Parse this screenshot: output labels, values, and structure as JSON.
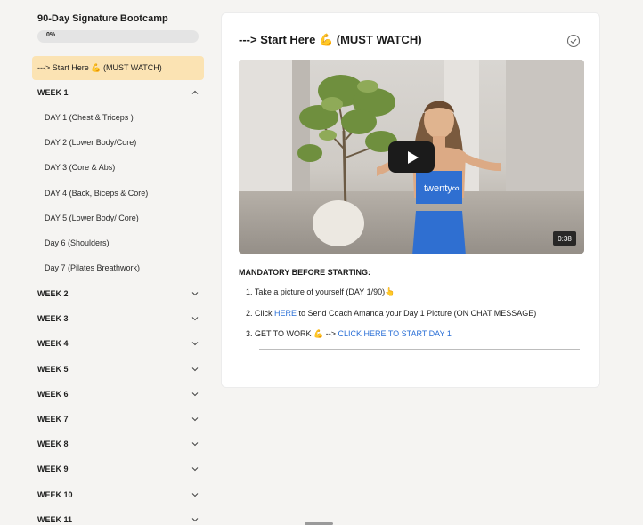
{
  "sidebar": {
    "course_title": "90-Day Signature Bootcamp",
    "progress_label": "0%",
    "progress_value": 0,
    "active_item": "---> Start Here 💪 (MUST WATCH)",
    "weeks": [
      {
        "label": "WEEK 1",
        "expanded": true
      },
      {
        "label": "WEEK 2",
        "expanded": false
      },
      {
        "label": "WEEK 3",
        "expanded": false
      },
      {
        "label": "WEEK 4",
        "expanded": false
      },
      {
        "label": "WEEK 5",
        "expanded": false
      },
      {
        "label": "WEEK 6",
        "expanded": false
      },
      {
        "label": "WEEK 7",
        "expanded": false
      },
      {
        "label": "WEEK 8",
        "expanded": false
      },
      {
        "label": "WEEK 9",
        "expanded": false
      },
      {
        "label": "WEEK 10",
        "expanded": false
      },
      {
        "label": "WEEK 11",
        "expanded": false
      }
    ],
    "week1_days": [
      "DAY 1 (Chest & Triceps )",
      "DAY 2 (Lower Body/Core)",
      "DAY 3 (Core & Abs)",
      "DAY 4 (Back, Biceps & Core)",
      "DAY 5 (Lower Body/ Core)",
      "Day 6 (Shoulders)",
      "Day 7 (Pilates Breathwork)"
    ]
  },
  "lesson": {
    "title": "---> Start Here 💪 (MUST WATCH)",
    "video": {
      "duration": "0:38",
      "shirt_text": "twenty∞"
    },
    "mandatory_heading": "MANDATORY BEFORE STARTING:",
    "steps": {
      "s1": "1. Take a picture of yourself (DAY 1/90)👆",
      "s2_prefix": "2. Click ",
      "s2_link": "HERE",
      "s2_suffix": " to Send Coach Amanda your Day 1 Picture (ON CHAT MESSAGE)",
      "s3_prefix": "3. GET TO WORK 💪  --> ",
      "s3_link": "CLICK HERE TO START DAY 1"
    }
  },
  "colors": {
    "active_bg": "#fbe3b3",
    "link": "#2a6fd6",
    "page_bg": "#f5f4f2"
  }
}
